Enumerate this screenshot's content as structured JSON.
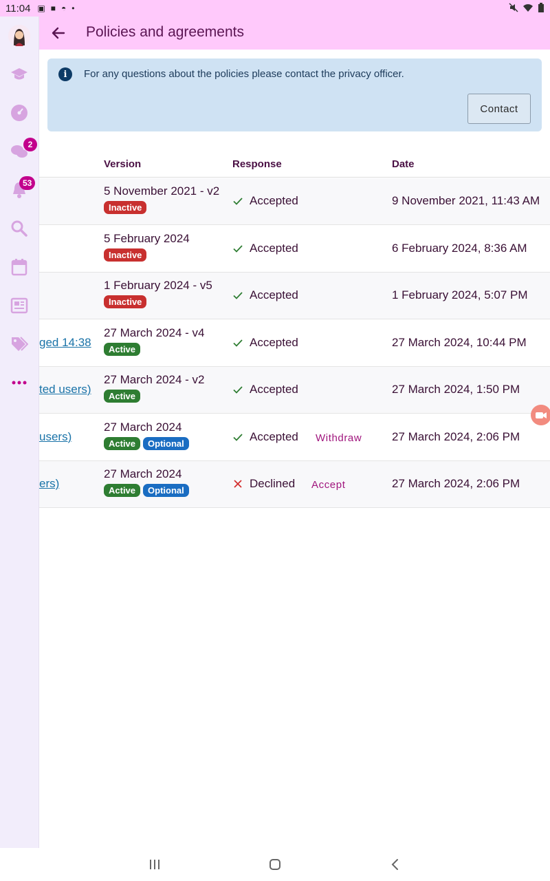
{
  "status_bar": {
    "time": "11:04"
  },
  "header": {
    "title": "Policies and agreements"
  },
  "rail": {
    "messages_badge": "2",
    "notifications_badge": "53"
  },
  "banner": {
    "message": "For any questions about the policies please contact the privacy officer.",
    "contact_label": "Contact"
  },
  "table": {
    "headers": {
      "version": "Version",
      "response": "Response",
      "date": "Date"
    },
    "rows": [
      {
        "name": "",
        "version": "5 November 2021 - v2",
        "status": "Inactive",
        "optional": "",
        "response": "Accepted",
        "action": "",
        "date": "9 November 2021, 11:43 AM"
      },
      {
        "name": "",
        "version": "5 February 2024",
        "status": "Inactive",
        "optional": "",
        "response": "Accepted",
        "action": "",
        "date": "6 February 2024, 8:36 AM"
      },
      {
        "name": "",
        "version": "1 February 2024 - v5",
        "status": "Inactive",
        "optional": "",
        "response": "Accepted",
        "action": "",
        "date": "1 February 2024, 5:07 PM"
      },
      {
        "name": "ged 14:38",
        "version": "27 March 2024 - v4",
        "status": "Active",
        "optional": "",
        "response": "Accepted",
        "action": "",
        "date": "27 March 2024, 10:44 PM"
      },
      {
        "name": "ted users)",
        "version": "27 March 2024 - v2",
        "status": "Active",
        "optional": "",
        "response": "Accepted",
        "action": "",
        "date": "27 March 2024, 1:50 PM"
      },
      {
        "name": "users)",
        "version": "27 March 2024",
        "status": "Active",
        "optional": "Optional",
        "response": "Accepted",
        "action": "Withdraw",
        "date": "27 March 2024, 2:06 PM"
      },
      {
        "name": "ers)",
        "version": "27 March 2024",
        "status": "Active",
        "optional": "Optional",
        "response": "Declined",
        "action": "Accept",
        "date": "27 March 2024, 2:06 PM"
      }
    ]
  },
  "colors": {
    "header_bg": "#ffc9fb",
    "rail_bg": "#f2edfb",
    "banner_bg": "#cfe2f3",
    "inactive": "#c8302f",
    "active": "#2e7d32",
    "optional": "#1a6dc2",
    "link": "#1a73a8",
    "action": "#a0157d",
    "accepted_check": "#2e7d32",
    "declined_x": "#d32f2f",
    "badge": "#c2008c"
  },
  "icons": {
    "rail": [
      "avatar",
      "graduation-cap-icon",
      "dashboard-icon",
      "chat-icon",
      "bell-icon",
      "search-icon",
      "calendar-icon",
      "newspaper-icon",
      "tags-icon",
      "more-icon"
    ],
    "navbar": [
      "recents-icon",
      "home-icon",
      "back-icon"
    ]
  }
}
